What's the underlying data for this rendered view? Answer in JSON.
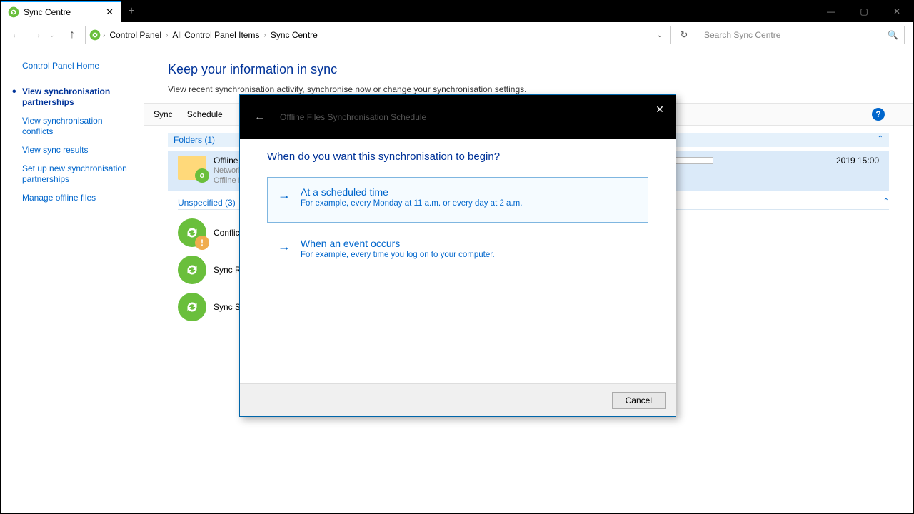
{
  "tab": {
    "title": "Sync Centre"
  },
  "breadcrumbs": {
    "a": "Control Panel",
    "b": "All Control Panel Items",
    "c": "Sync Centre"
  },
  "search": {
    "placeholder": "Search Sync Centre"
  },
  "sidebar": {
    "home": "Control Panel Home",
    "partnerships": "View synchronisation partnerships",
    "conflicts": "View synchronisation conflicts",
    "results": "View sync results",
    "setup": "Set up new synchronisation partnerships",
    "manage": "Manage offline files"
  },
  "content": {
    "heading": "Keep your information in sync",
    "sub": "View recent synchronisation activity, synchronise now or change your synchronisation settings.",
    "toolbar": {
      "sync": "Sync",
      "schedule": "Schedule"
    },
    "group_folders": "Folders (1)",
    "offline": {
      "title": "Offline Files",
      "desc1": "Network files available offline",
      "desc2": "Offline Files allows you to acc..."
    },
    "progress_extra": "2019 15:00",
    "group_unspecified": "Unspecified (3)",
    "conflicts": "Conflicts",
    "sync_results": "Sync Results",
    "sync_setup": "Sync Setup"
  },
  "dialog": {
    "title": "Offline Files Synchronisation Schedule",
    "heading": "When do you want this synchronisation to begin?",
    "opt1_title": "At a scheduled time",
    "opt1_desc": "For example, every Monday at 11 a.m. or every day at 2 a.m.",
    "opt2_title": "When an event occurs",
    "opt2_desc": "For example, every time you log on to your computer.",
    "cancel": "Cancel"
  }
}
